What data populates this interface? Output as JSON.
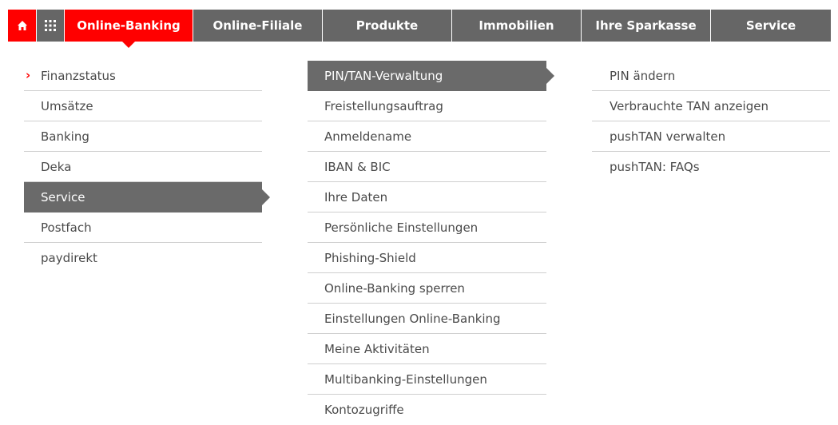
{
  "topnav": {
    "home_icon": "home-icon",
    "apps_icon": "grid-icon",
    "items": [
      {
        "label": "Online-Banking"
      },
      {
        "label": "Online-Filiale"
      },
      {
        "label": "Produkte"
      },
      {
        "label": "Immobilien"
      },
      {
        "label": "Ihre Sparkasse"
      },
      {
        "label": "Service"
      }
    ]
  },
  "menu": {
    "col1": [
      {
        "label": "Finanzstatus"
      },
      {
        "label": "Umsätze"
      },
      {
        "label": "Banking"
      },
      {
        "label": "Deka"
      },
      {
        "label": "Service"
      },
      {
        "label": "Postfach"
      },
      {
        "label": "paydirekt"
      }
    ],
    "col2": [
      {
        "label": "PIN/TAN-Verwaltung"
      },
      {
        "label": "Freistellungsauftrag"
      },
      {
        "label": "Anmeldename"
      },
      {
        "label": "IBAN & BIC"
      },
      {
        "label": "Ihre Daten"
      },
      {
        "label": "Persönliche Einstellungen"
      },
      {
        "label": "Phishing-Shield"
      },
      {
        "label": "Online-Banking sperren"
      },
      {
        "label": "Einstellungen Online-Banking"
      },
      {
        "label": "Meine Aktivitäten"
      },
      {
        "label": "Multibanking-Einstellungen"
      },
      {
        "label": "Kontozugriffe"
      }
    ],
    "col3": [
      {
        "label": "PIN ändern"
      },
      {
        "label": "Verbrauchte TAN anzeigen"
      },
      {
        "label": "pushTAN verwalten"
      },
      {
        "label": "pushTAN: FAQs"
      }
    ]
  },
  "colors": {
    "brand_red": "#ff0000",
    "nav_grey": "#666666",
    "active_grey": "#6a6a6a"
  }
}
